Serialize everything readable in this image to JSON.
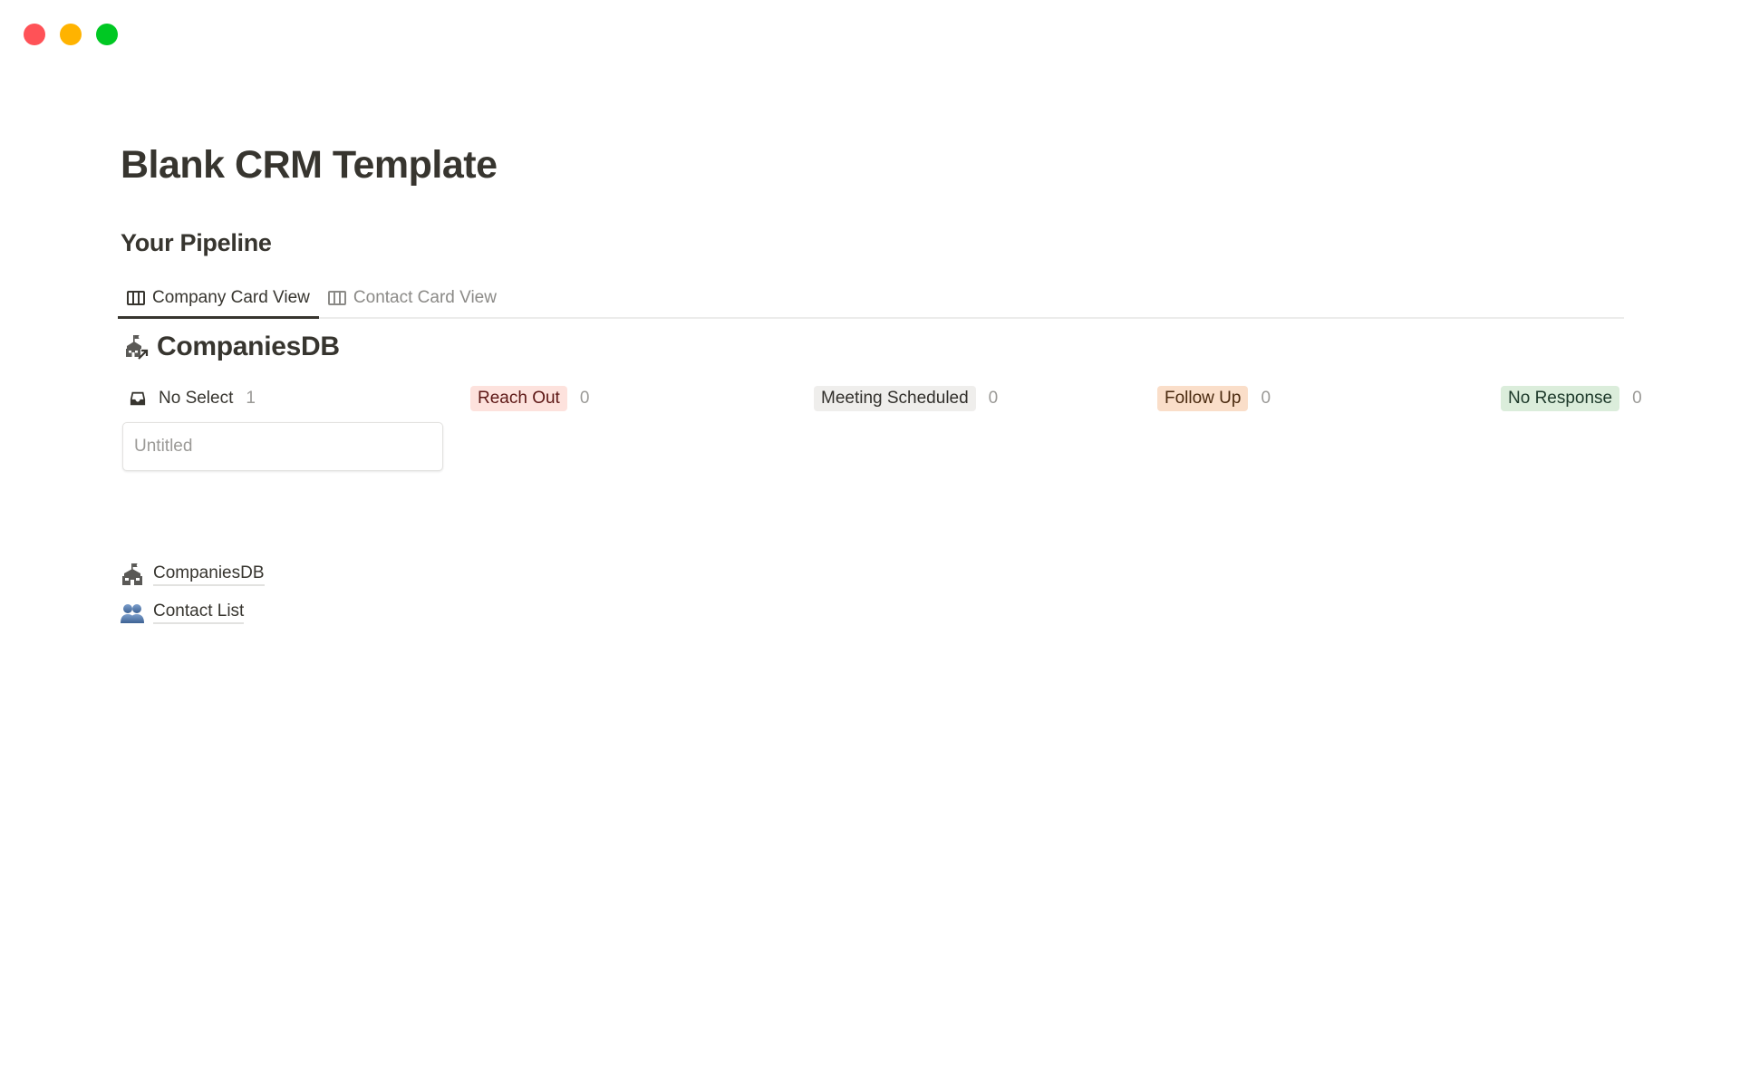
{
  "window": {
    "controls": [
      "close",
      "minimize",
      "zoom"
    ]
  },
  "page": {
    "title": "Blank CRM Template",
    "section_heading": "Your Pipeline"
  },
  "tabs": [
    {
      "label": "Company Card View",
      "icon": "board-icon",
      "active": true
    },
    {
      "label": "Contact Card View",
      "icon": "board-icon",
      "active": false
    }
  ],
  "database": {
    "title": "CompaniesDB",
    "icon": "school-building-link-icon"
  },
  "groups": [
    {
      "label": "No Select",
      "count": "1",
      "icon": "inbox-icon",
      "bg": "",
      "fg": "#37352f"
    },
    {
      "label": "Reach Out",
      "count": "0",
      "bg": "#fde2dd",
      "fg": "#5d1715"
    },
    {
      "label": "Meeting Scheduled",
      "count": "0",
      "bg": "#efeeec",
      "fg": "#32302c"
    },
    {
      "label": "Follow Up",
      "count": "0",
      "bg": "#fadec9",
      "fg": "#49290e"
    },
    {
      "label": "No Response",
      "count": "0",
      "bg": "#dbeddb",
      "fg": "#1c3829"
    }
  ],
  "cards": [
    {
      "title": "Untitled",
      "group": "No Select"
    }
  ],
  "links": [
    {
      "label": "CompaniesDB",
      "icon": "school-building-icon"
    },
    {
      "label": "Contact List",
      "icon": "people-icon"
    }
  ]
}
